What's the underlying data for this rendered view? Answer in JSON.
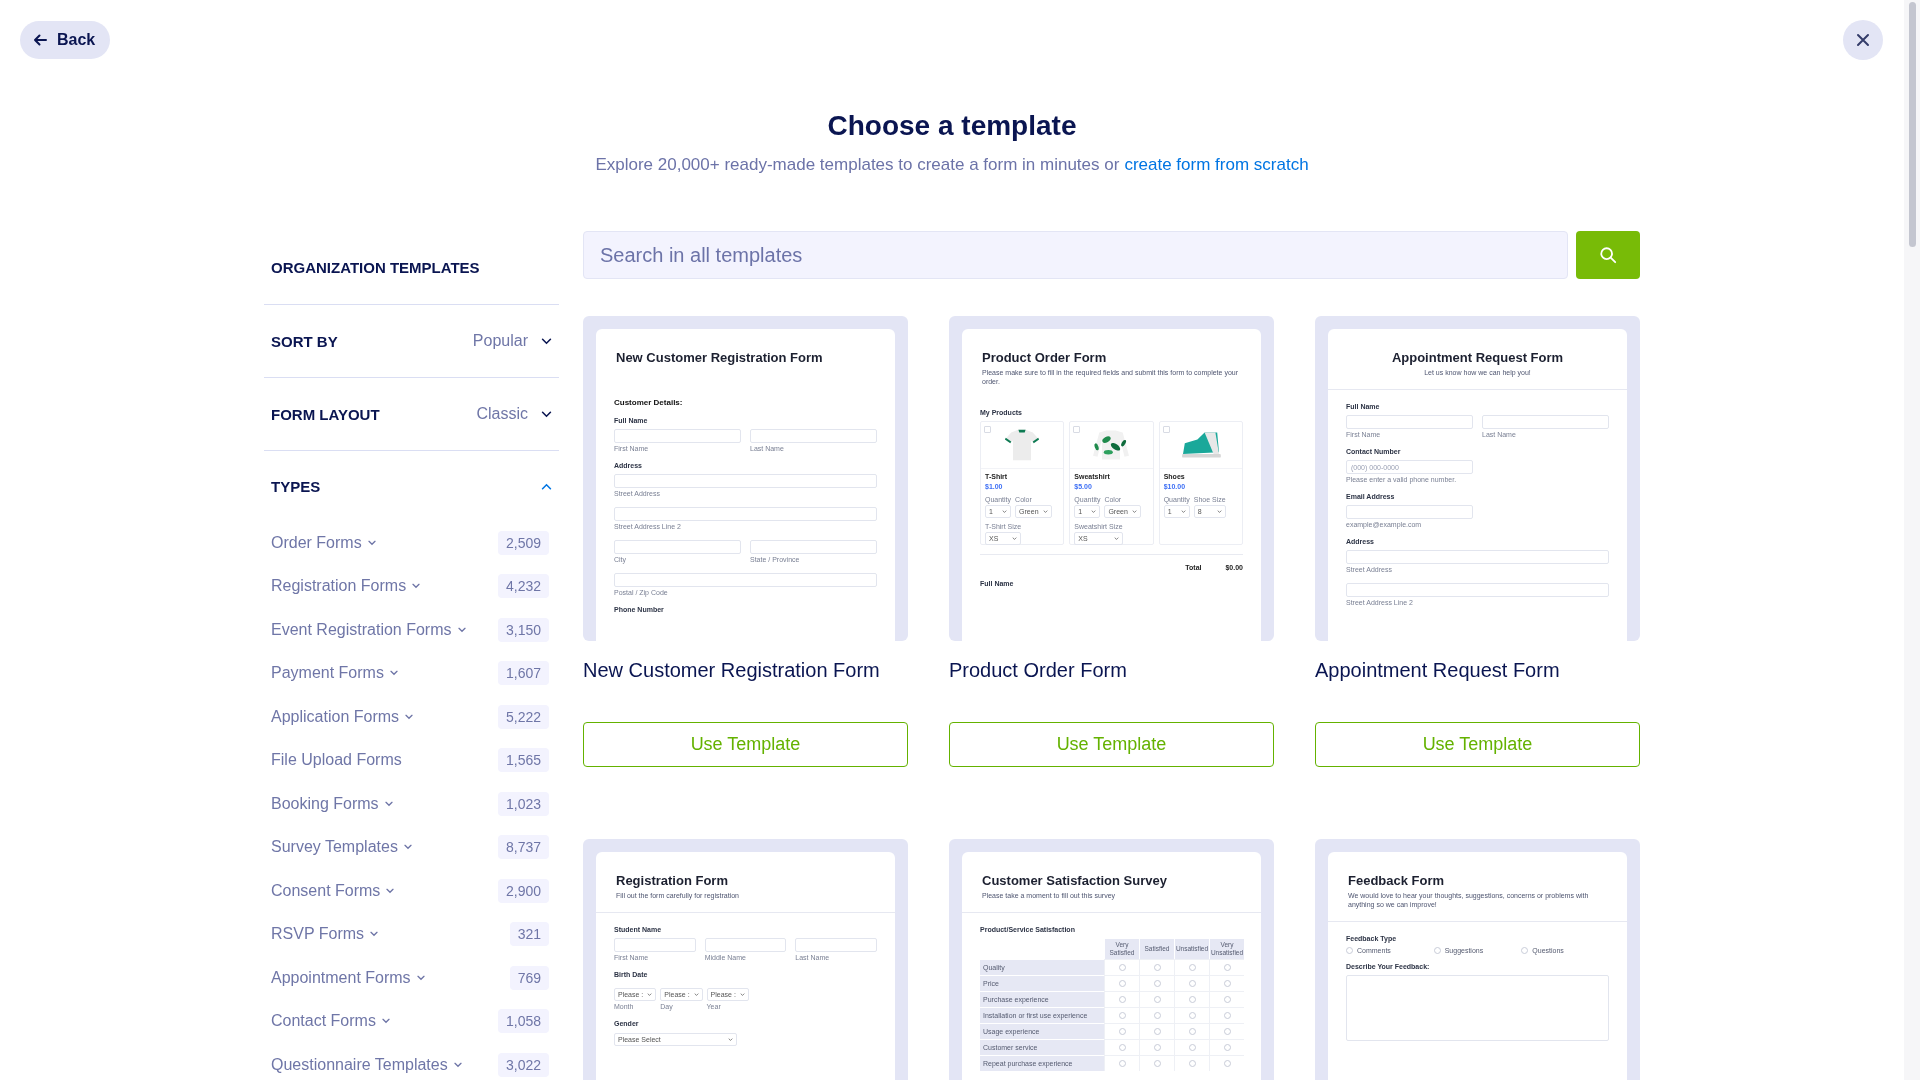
{
  "back_button": {
    "label": "Back"
  },
  "header": {
    "title": "Choose a template",
    "subtitle": "Explore 20,000+ ready-made templates to create a form in minutes or",
    "link": "create form from scratch"
  },
  "sidebar": {
    "heading": "ORGANIZATION TEMPLATES",
    "filters": [
      {
        "label": "SORT BY",
        "value": "Popular"
      },
      {
        "label": "FORM LAYOUT",
        "value": "Classic"
      }
    ],
    "types": {
      "label": "TYPES",
      "expanded": true,
      "items": [
        {
          "name": "Order Forms",
          "expandable": true,
          "count": "2,509"
        },
        {
          "name": "Registration Forms",
          "expandable": true,
          "count": "4,232"
        },
        {
          "name": "Event Registration Forms",
          "expandable": true,
          "count": "3,150"
        },
        {
          "name": "Payment Forms",
          "expandable": true,
          "count": "1,607"
        },
        {
          "name": "Application Forms",
          "expandable": true,
          "count": "5,222"
        },
        {
          "name": "File Upload Forms",
          "expandable": false,
          "count": "1,565"
        },
        {
          "name": "Booking Forms",
          "expandable": true,
          "count": "1,023"
        },
        {
          "name": "Survey Templates",
          "expandable": true,
          "count": "8,737"
        },
        {
          "name": "Consent Forms",
          "expandable": true,
          "count": "2,900"
        },
        {
          "name": "RSVP Forms",
          "expandable": true,
          "count": "321"
        },
        {
          "name": "Appointment Forms",
          "expandable": true,
          "count": "769"
        },
        {
          "name": "Contact Forms",
          "expandable": true,
          "count": "1,058"
        },
        {
          "name": "Questionnaire Templates",
          "expandable": true,
          "count": "3,022"
        }
      ]
    }
  },
  "search": {
    "placeholder": "Search in all templates"
  },
  "templates": [
    {
      "name": "New Customer Registration Form",
      "button": "Use Template",
      "preview": {
        "title": "New Customer Registration Form",
        "centered": false,
        "blocks": [
          {
            "kind": "heading",
            "text": "Customer Details:"
          },
          {
            "kind": "label",
            "text": "Full Name"
          },
          {
            "kind": "inputs",
            "fields": [
              {
                "sublabel": "First Name"
              },
              {
                "sublabel": "Last Name"
              }
            ]
          },
          {
            "kind": "label",
            "text": "Address"
          },
          {
            "kind": "inputs",
            "fields": [
              {
                "sublabel": "Street Address"
              }
            ]
          },
          {
            "kind": "inputs",
            "fields": [
              {
                "sublabel": "Street Address Line 2"
              }
            ]
          },
          {
            "kind": "inputs",
            "fields": [
              {
                "sublabel": "City"
              },
              {
                "sublabel": "State / Province"
              }
            ]
          },
          {
            "kind": "inputs",
            "fields": [
              {
                "sublabel": "Postal / Zip Code"
              }
            ]
          },
          {
            "kind": "label",
            "text": "Phone Number"
          }
        ]
      }
    },
    {
      "name": "Product Order Form",
      "button": "Use Template",
      "preview": {
        "title": "Product Order Form",
        "subtitle": "Please make sure to fill in the required fields and submit this form to complete your order.",
        "centered": false,
        "blocks": [
          {
            "kind": "label",
            "text": "My Products"
          },
          {
            "kind": "products",
            "items": [
              {
                "name": "T-Shirt",
                "price": "$1.00",
                "checked": false,
                "option_rows": [
                  [
                    {
                      "label": "Quantity",
                      "value": "1"
                    },
                    {
                      "label": "Color",
                      "value": "Green"
                    }
                  ],
                  [
                    {
                      "label": "T-Shirt Size",
                      "value": "XS"
                    }
                  ]
                ]
              },
              {
                "name": "Sweatshirt",
                "price": "$5.00",
                "checked": false,
                "option_rows": [
                  [
                    {
                      "label": "Quantity",
                      "value": "1"
                    },
                    {
                      "label": "Color",
                      "value": "Green"
                    }
                  ],
                  [
                    {
                      "label": "Sweatshirt Size",
                      "value": "XS"
                    }
                  ]
                ]
              },
              {
                "name": "Shoes",
                "price": "$10.00",
                "checked": false,
                "option_rows": [
                  [
                    {
                      "label": "Quantity",
                      "value": "1"
                    },
                    {
                      "label": "Shoe Size",
                      "value": "8"
                    }
                  ]
                ]
              }
            ]
          },
          {
            "kind": "divider"
          },
          {
            "kind": "total",
            "label": "Total",
            "value": "$0.00"
          },
          {
            "kind": "label",
            "text": "Full Name"
          }
        ]
      }
    },
    {
      "name": "Appointment Request Form",
      "button": "Use Template",
      "preview": {
        "title": "Appointment Request Form",
        "subtitle": "Let us know how we can help you!",
        "centered": true,
        "header_divider": true,
        "blocks": [
          {
            "kind": "label",
            "text": "Full Name"
          },
          {
            "kind": "inputs",
            "fields": [
              {
                "sublabel": "First Name"
              },
              {
                "sublabel": "Last Name"
              }
            ]
          },
          {
            "kind": "label",
            "text": "Contact Number"
          },
          {
            "kind": "short_input",
            "fields": [
              {
                "placeholder": "(000) 000-0000",
                "sublabel": "Please enter a valid phone number."
              }
            ]
          },
          {
            "kind": "label",
            "text": "Email Address"
          },
          {
            "kind": "short_input",
            "fields": [
              {
                "sublabel": "example@example.com"
              }
            ]
          },
          {
            "kind": "label",
            "text": "Address"
          },
          {
            "kind": "inputs",
            "fields": [
              {
                "sublabel": "Street Address"
              }
            ]
          },
          {
            "kind": "inputs",
            "fields": [
              {
                "sublabel": "Street Address Line 2"
              }
            ]
          }
        ]
      }
    },
    {
      "preview": {
        "title": "Registration Form",
        "subtitle": "Fill out the form carefully for registration",
        "centered": false,
        "header_divider": true,
        "blocks": [
          {
            "kind": "label",
            "text": "Student Name"
          },
          {
            "kind": "inputs",
            "fields": [
              {
                "sublabel": "First Name"
              },
              {
                "sublabel": "Middle Name"
              },
              {
                "sublabel": "Last Name"
              }
            ]
          },
          {
            "kind": "label",
            "text": "Birth Date"
          },
          {
            "kind": "selects",
            "fields": [
              {
                "value": "Please :",
                "sublabel": "Month"
              },
              {
                "value": "Please :",
                "sublabel": "Day"
              },
              {
                "value": "Please :",
                "sublabel": "Year"
              }
            ]
          },
          {
            "kind": "label",
            "text": "Gender"
          },
          {
            "kind": "dropdown",
            "value": "Please Select"
          }
        ]
      }
    },
    {
      "preview": {
        "title": "Customer Satisfaction Survey",
        "subtitle": "Please take a moment to fill out this survey",
        "centered": false,
        "header_divider": true,
        "blocks": [
          {
            "kind": "label",
            "text": "Product/Service Satisfaction"
          },
          {
            "kind": "matrix",
            "columns": [
              "Very Satisfied",
              "Satisfied",
              "Unsatisfied",
              "Very Unsatisfied"
            ],
            "rows": [
              {
                "label": "Quality",
                "checked": [
                  false,
                  false,
                  false,
                  false
                ]
              },
              {
                "label": "Price",
                "checked": [
                  false,
                  false,
                  false,
                  false
                ]
              },
              {
                "label": "Purchase experience",
                "checked": [
                  false,
                  false,
                  false,
                  false
                ]
              },
              {
                "label": "Installation or first use experience",
                "checked": [
                  false,
                  false,
                  false,
                  false
                ]
              },
              {
                "label": "Usage experience",
                "checked": [
                  false,
                  false,
                  false,
                  false
                ]
              },
              {
                "label": "Customer service",
                "checked": [
                  false,
                  false,
                  false,
                  false
                ]
              },
              {
                "label": "Repeat purchase experience",
                "checked": [
                  false,
                  false,
                  false,
                  false
                ]
              }
            ]
          }
        ]
      }
    },
    {
      "preview": {
        "title": "Feedback Form",
        "subtitle": "We would love to hear your thoughts, suggestions, concerns or problems with anything so we can improve!",
        "centered": false,
        "header_divider": true,
        "blocks": [
          {
            "kind": "label",
            "text": "Feedback Type"
          },
          {
            "kind": "radios",
            "options": [
              {
                "label": "Comments",
                "selected": false
              },
              {
                "label": "Suggestions",
                "selected": false
              },
              {
                "label": "Questions",
                "selected": false
              }
            ]
          },
          {
            "kind": "label",
            "text": "Describe Your Feedback:"
          },
          {
            "kind": "textarea"
          }
        ]
      }
    }
  ]
}
